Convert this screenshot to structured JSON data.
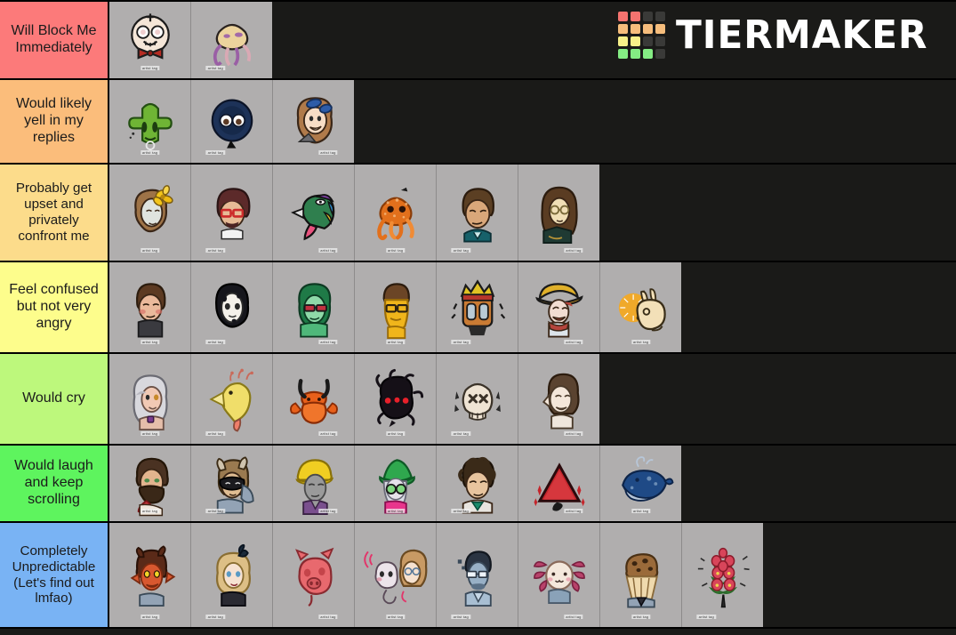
{
  "brand": {
    "name": "TIERMAKER",
    "logo_grid": [
      [
        "#f4736f",
        "#f4736f",
        "#3a3a38",
        "#3a3a38"
      ],
      [
        "#f6bd7c",
        "#f6bd7c",
        "#f6bd7c",
        "#f6bd7c"
      ],
      [
        "#f7f089",
        "#f7f089",
        "#3a3a38",
        "#3a3a38"
      ],
      [
        "#84ec83",
        "#84ec83",
        "#84ec83",
        "#3a3a38"
      ]
    ],
    "text_color": "#ffffff"
  },
  "background_color": "#1a1a18",
  "cell_background": "#b0aeae",
  "tiers": [
    {
      "label": "Will Block Me Immediately",
      "color": "#fc7a7a",
      "items": [
        {
          "name": "skull-clown-bowtie-avatar",
          "watermark": "artist tag"
        },
        {
          "name": "pale-octopus-avatar",
          "watermark": "artist tag"
        }
      ]
    },
    {
      "label": "Would likely yell in my replies",
      "color": "#fbbd7b",
      "items": [
        {
          "name": "green-cactus-avatar",
          "watermark": "artist tag"
        },
        {
          "name": "dark-blue-blob-eyes-avatar",
          "watermark": "artist tag"
        },
        {
          "name": "curly-hair-goggles-girl-avatar",
          "watermark": "artist tag"
        }
      ]
    },
    {
      "label": "Probably get upset and privately confront me",
      "color": "#fcdc8b",
      "items": [
        {
          "name": "yellow-flower-hair-avatar",
          "watermark": "artist tag"
        },
        {
          "name": "red-glasses-beard-avatar",
          "watermark": "artist tag"
        },
        {
          "name": "rainbow-bird-head-avatar",
          "watermark": "artist tag"
        },
        {
          "name": "orange-speckled-octopus-avatar",
          "watermark": "artist tag"
        },
        {
          "name": "brown-hair-teal-collar-avatar",
          "watermark": "artist tag"
        },
        {
          "name": "long-hair-glasses-avatar",
          "watermark": "artist tag"
        }
      ]
    },
    {
      "label": "Feel confused but not very angry",
      "color": "#fdfd8c",
      "items": [
        {
          "name": "blushing-turtleneck-avatar",
          "watermark": "artist tag"
        },
        {
          "name": "white-mask-black-hair-avatar",
          "watermark": "artist tag"
        },
        {
          "name": "green-hair-sunglasses-avatar",
          "watermark": "artist tag"
        },
        {
          "name": "yellow-skin-glasses-avatar",
          "watermark": "artist tag"
        },
        {
          "name": "crown-lantern-head-avatar",
          "watermark": "artist tag"
        },
        {
          "name": "pirate-hat-laughing-avatar",
          "watermark": "artist tag"
        },
        {
          "name": "rabbit-sun-avatar",
          "watermark": "artist tag"
        }
      ]
    },
    {
      "label": "Would cry",
      "color": "#bdf87c",
      "items": [
        {
          "name": "white-wavy-hair-avatar",
          "watermark": "artist tag"
        },
        {
          "name": "yellow-chocobo-bird-avatar",
          "watermark": "artist tag"
        },
        {
          "name": "orange-crab-avatar",
          "watermark": "artist tag"
        },
        {
          "name": "dark-red-eyes-creature-avatar",
          "watermark": "artist tag"
        },
        {
          "name": "skull-x-eyes-avatar",
          "watermark": "artist tag"
        },
        {
          "name": "pointed-ear-smiling-avatar",
          "watermark": "artist tag"
        }
      ]
    },
    {
      "label": "Would laugh and keep scrolling",
      "color": "#5ef45e",
      "items": [
        {
          "name": "bearded-tongue-mask-avatar",
          "watermark": "artist tag"
        },
        {
          "name": "masked-horned-avatar",
          "watermark": "artist tag"
        },
        {
          "name": "yellow-cap-grey-face-avatar",
          "watermark": "artist tag"
        },
        {
          "name": "green-witch-hat-avatar",
          "watermark": "artist tag"
        },
        {
          "name": "curly-hair-green-collar-avatar",
          "watermark": "artist tag"
        },
        {
          "name": "red-triangle-avatar",
          "watermark": "artist tag"
        },
        {
          "name": "blue-whale-avatar",
          "watermark": "artist tag"
        }
      ]
    },
    {
      "label": "Completely Unpredictable (Let's find out lmfao)",
      "color": "#79b3f4",
      "items": [
        {
          "name": "red-horned-demon-avatar",
          "watermark": "artist tag"
        },
        {
          "name": "blonde-bow-lady-avatar",
          "watermark": "artist tag"
        },
        {
          "name": "pink-pig-avatar",
          "watermark": "artist tag"
        },
        {
          "name": "headphones-ghost-pair-avatar",
          "watermark": "artist tag"
        },
        {
          "name": "blue-glasses-man-avatar",
          "watermark": "artist tag"
        },
        {
          "name": "axolotl-avatar",
          "watermark": "artist tag"
        },
        {
          "name": "muffin-avatar",
          "watermark": "artist tag"
        },
        {
          "name": "pink-flowers-bouquet-avatar",
          "watermark": "artist tag"
        }
      ]
    }
  ]
}
